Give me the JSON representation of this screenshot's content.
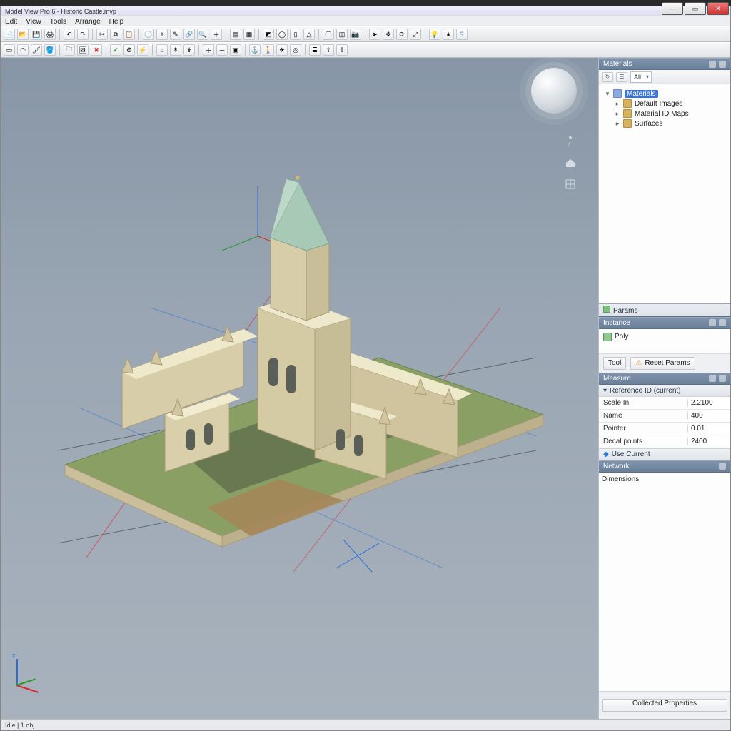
{
  "title": "Model View Pro 6 - Historic Castle.mvp",
  "menu": [
    "Edit",
    "View",
    "Tools",
    "Arrange",
    "Help"
  ],
  "status": "Idle | 1 obj",
  "winControls": {
    "min": "—",
    "max": "▭",
    "close": "✕"
  },
  "viewTools": [
    "person-icon",
    "cloud-icon",
    "grid-icon"
  ],
  "axisLabel": "z",
  "side": {
    "materials": {
      "title": "Materials",
      "miniTabs": [
        "All"
      ],
      "tree": {
        "root": "Materials",
        "children": [
          "Default Images",
          "Material ID Maps",
          "Surfaces"
        ]
      }
    },
    "params": {
      "title": "Params",
      "subTitle": "Instance",
      "item": "Poly",
      "footerBtns": [
        "Tool",
        "Reset Params"
      ]
    },
    "measure": {
      "title": "Measure",
      "section": "Reference ID (current)",
      "rows": [
        {
          "k": "Scale In",
          "v": "2.2100"
        },
        {
          "k": "Name",
          "v": "400"
        },
        {
          "k": "Pointer",
          "v": "0.01"
        },
        {
          "k": "Decal points",
          "v": "2400"
        }
      ],
      "action": "Use Current"
    },
    "network": {
      "title": "Network",
      "body": "Dimensions"
    },
    "bottomBtn": "Collected Properties"
  }
}
